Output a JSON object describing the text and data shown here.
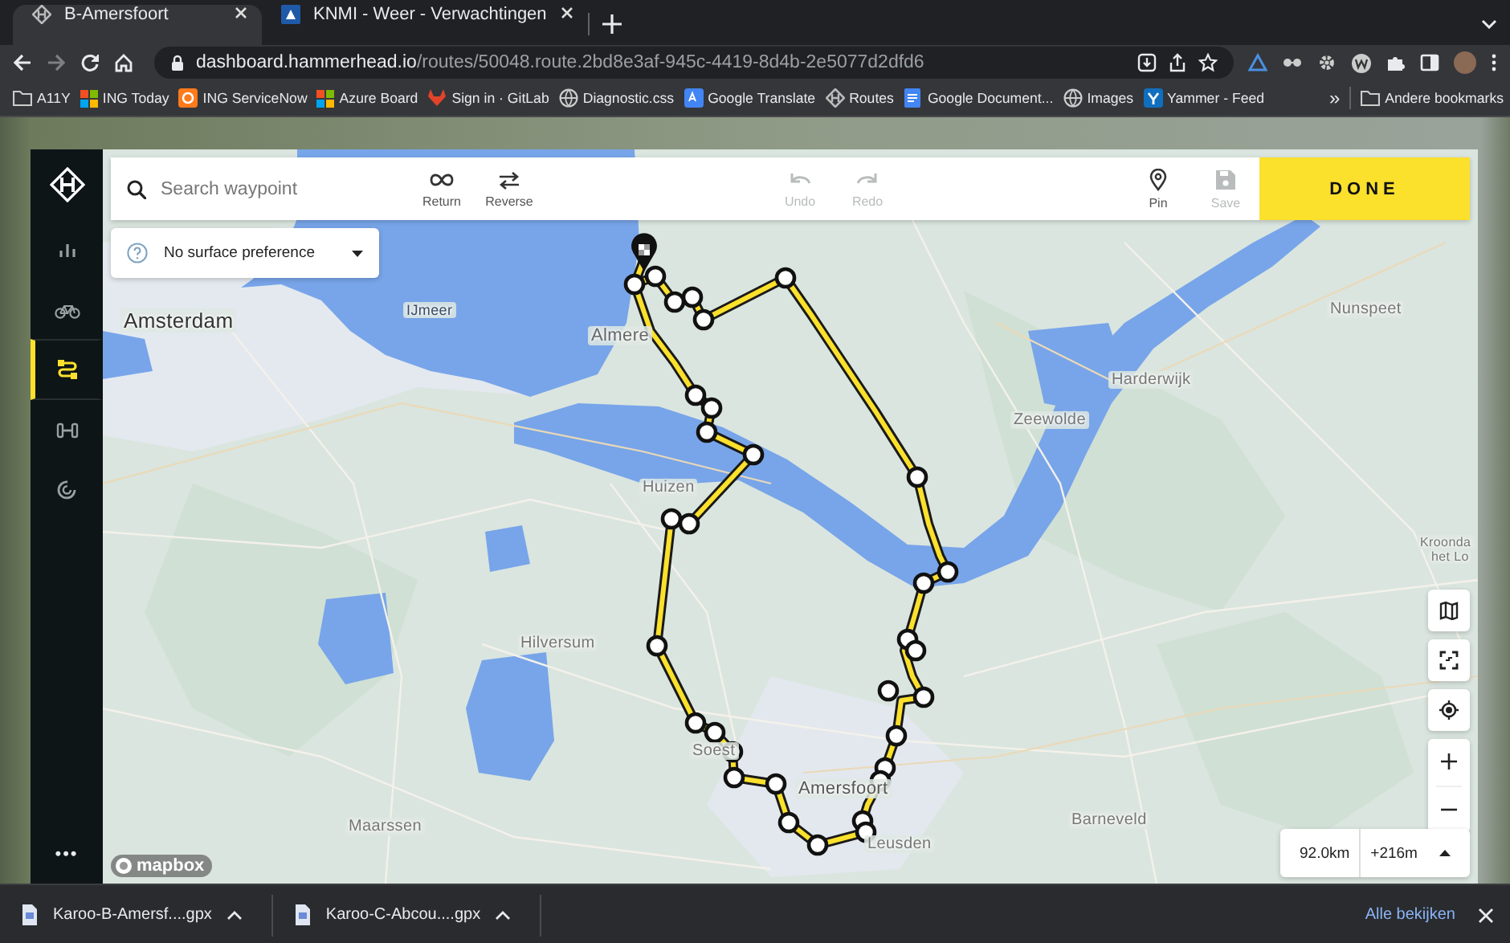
{
  "browser": {
    "tabs": [
      {
        "title": "B-Amersfoort",
        "selected": true,
        "kind": "hexagon"
      },
      {
        "title": "KNMI - Weer - Verwachtingen",
        "selected": false,
        "kind": "knmi"
      }
    ],
    "url": {
      "host": "dashboard.hammerhead.io",
      "path": "/routes/50048.route.2bd8e3af-945c-4419-8d4b-2e5077d2dfd6"
    },
    "bookmarks": [
      {
        "label": "A11Y",
        "kind": "folder"
      },
      {
        "label": "ING Today",
        "kind": "tiles"
      },
      {
        "label": "ING ServiceNow",
        "kind": "orange"
      },
      {
        "label": "Azure Board",
        "kind": "tiles"
      },
      {
        "label": "Sign in · GitLab",
        "kind": "gitlab"
      },
      {
        "label": "Diagnostic.css",
        "kind": "globe"
      },
      {
        "label": "Google Translate",
        "kind": "translate"
      },
      {
        "label": "Routes",
        "kind": "hexagon"
      },
      {
        "label": "Google Document...",
        "kind": "doc"
      },
      {
        "label": "Images",
        "kind": "globe"
      },
      {
        "label": "Yammer - Feed",
        "kind": "yammer"
      }
    ],
    "bookmarks_more": "»",
    "other_bookmarks": "Andere bookmarks"
  },
  "sidebar": {
    "items": [
      {
        "kind": "stats",
        "selected": false
      },
      {
        "kind": "bike",
        "selected": false
      },
      {
        "kind": "route",
        "selected": true
      },
      {
        "kind": "workout",
        "selected": false
      },
      {
        "kind": "progress",
        "selected": false
      }
    ],
    "more": "•••"
  },
  "toolbar": {
    "search": {
      "placeholder": "Search waypoint"
    },
    "actions": [
      {
        "kind": "return",
        "label": "Return",
        "disabled": false
      },
      {
        "kind": "reverse",
        "label": "Reverse",
        "disabled": false
      },
      {
        "kind": "undo",
        "label": "Undo",
        "disabled": true
      },
      {
        "kind": "redo",
        "label": "Redo",
        "disabled": true
      },
      {
        "kind": "pin",
        "label": "Pin",
        "disabled": false
      },
      {
        "kind": "save",
        "label": "Save",
        "disabled": true
      }
    ],
    "done": "DONE"
  },
  "surface": {
    "value": "No surface preference"
  },
  "map": {
    "labels": [
      "Amsterdam",
      "IJmeer",
      "Almere",
      "Huizen",
      "Hilversum",
      "Soest",
      "Maarssen",
      "Amersfoort",
      "Leusden",
      "Barneveld",
      "Zeewolde",
      "Harderwijk",
      "Nunspeet",
      "Kroonda",
      "het Lo"
    ],
    "attribution": "mapbox"
  },
  "route_summary": {
    "distance": "92.0km",
    "elevation": "+216m"
  },
  "downloads": {
    "items": [
      "Karoo-B-Amersf....gpx",
      "Karoo-C-Abcou....gpx"
    ],
    "show_all": "Alle bekijken"
  }
}
